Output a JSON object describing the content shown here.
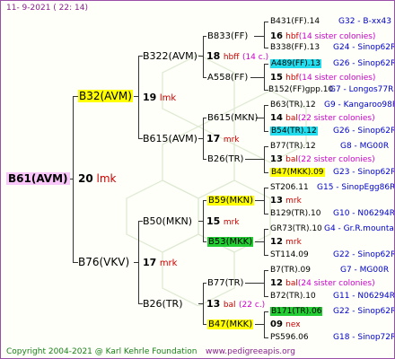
{
  "header": {
    "date": "11-  9-2021 (  22:  14)"
  },
  "footer": {
    "copyright": "Copyright 2004-2021 @ Karl Kehrle Foundation",
    "website": "www.pedigreeapis.org"
  },
  "root": {
    "name": "B61(AVM)",
    "year": "20",
    "code": "lmk"
  },
  "gen1": [
    {
      "name": "B32(AVM)",
      "year": "19",
      "code": "lmk"
    },
    {
      "name": "B76(VKV)",
      "year": "17",
      "code": "mrk"
    }
  ],
  "gen2": [
    {
      "name": "B322(AVM)",
      "year": "18",
      "code": "hbff",
      "note": "(14 c.)"
    },
    {
      "name": "B615(AVM)",
      "year": "17",
      "code": "mrk"
    },
    {
      "name": "B50(MKN)",
      "year": "15",
      "code": "mrk"
    },
    {
      "name": "B26(TR)",
      "year": "13",
      "code": "bal",
      "note": "(22 c.)"
    }
  ],
  "gen3": [
    {
      "name": "B833(FF)"
    },
    {
      "name": "A558(FF)"
    },
    {
      "name": "B615(MKN)",
      "year": "14",
      "code": "bal",
      "note": "(22 sister colonies)"
    },
    {
      "name": "B26(TR)",
      "year": "13",
      "code": "bal",
      "note": "(22 sister colonies)"
    },
    {
      "name": "B59(MKN)",
      "year": "13",
      "code": "mrk"
    },
    {
      "name": "B53(MKK)",
      "year": "12",
      "code": "mrk"
    },
    {
      "name": "B77(TR)",
      "year": "12",
      "code": "bal",
      "note": "(24 sister colonies)"
    },
    {
      "name": "B47(MKK)",
      "year": "09",
      "code": "nex"
    }
  ],
  "gen3_meta": [
    {
      "year": "18",
      "code": "hbff",
      "note": "(14 c.)"
    },
    {
      "year": "",
      "code": "",
      "note": ""
    }
  ],
  "gen4": [
    {
      "name": "B431(FF).14",
      "group": "G32 - B-xx43"
    },
    {
      "mid_year": "16",
      "mid_code": "hbf",
      "mid_note": "(14 sister colonies)"
    },
    {
      "name": "B338(FF).13",
      "group": "G24 - Sinop62R"
    },
    {
      "name": "A489(FF).13",
      "group": "G26 - Sinop62R"
    },
    {
      "mid_year": "15",
      "mid_code": "hbf",
      "mid_note": "(14 sister colonies)"
    },
    {
      "name": "B152(FF)gpp.10",
      "group": "G7 - Longos77R"
    },
    {
      "name": "B63(TR).12",
      "group": "G9 - Kangaroo98R"
    },
    {
      "name": "B54(TR).12",
      "group": "G26 - Sinop62R"
    },
    {
      "name": "B77(TR).12",
      "group": "G8 - MG00R"
    },
    {
      "name": "B47(MKK).09",
      "group": "G23 - Sinop62R"
    },
    {
      "name": "ST206.11",
      "group": "G15 - SinopEgg86R"
    },
    {
      "name": "B129(TR).10",
      "group": "G10 - N06294R"
    },
    {
      "name": "GR73(TR).10",
      "group": "G4 - Gr.R.mounta"
    },
    {
      "name": "ST114.09",
      "group": "G22 - Sinop62R"
    },
    {
      "name": "B7(TR).09",
      "group": "G7 - MG00R"
    },
    {
      "name": "B72(TR).10",
      "group": "G11 - N06294R"
    },
    {
      "name": "B171(TR).06",
      "group": "G22 - Sinop62R"
    },
    {
      "name": "PS596.06",
      "group": "G18 - Sinop72R"
    }
  ]
}
